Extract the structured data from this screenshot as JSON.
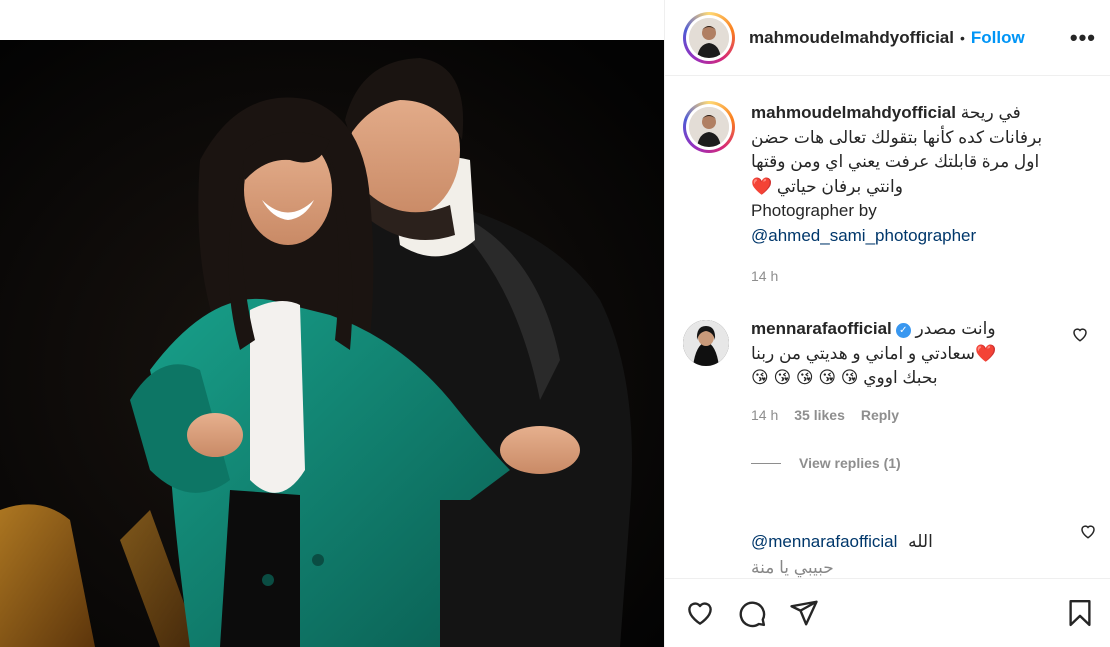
{
  "post": {
    "username": "mahmoudelmahdyofficial",
    "dot": "•",
    "follow_label": "Follow",
    "more_label": "•••"
  },
  "caption": {
    "username": "mahmoudelmahdyofficial",
    "line1": "في ريحة",
    "line2": "برفانات كده كأنها بتقولك تعالى هات حضن",
    "line3": "اول مرة قابلتك عرفت يعني اي ومن وقتها",
    "line4": "وانتي برفان حياتي",
    "heart": "❤️",
    "photographer": "Photographer by",
    "mention": "@ahmed_sami_photographer",
    "time": "14 h"
  },
  "comment1": {
    "username": "mennarafaofficial",
    "verified": "✓",
    "line1": "وانت مصدر",
    "line2": "سعادتي و اماني و هديتي من ربنا❤️",
    "line3": "😘 😘 😘 😘 😘 بحبك اووي",
    "time": "14 h",
    "likes": "35 likes",
    "reply_label": "Reply",
    "view_replies": "View replies (1)"
  },
  "comment2": {
    "mention": "@mennarafaofficial",
    "text": "الله",
    "ghost": "حبيبي يا منة"
  },
  "colors": {
    "accent": "#0095f6",
    "coat": "#0f7f6e",
    "jacket": "#121212"
  }
}
